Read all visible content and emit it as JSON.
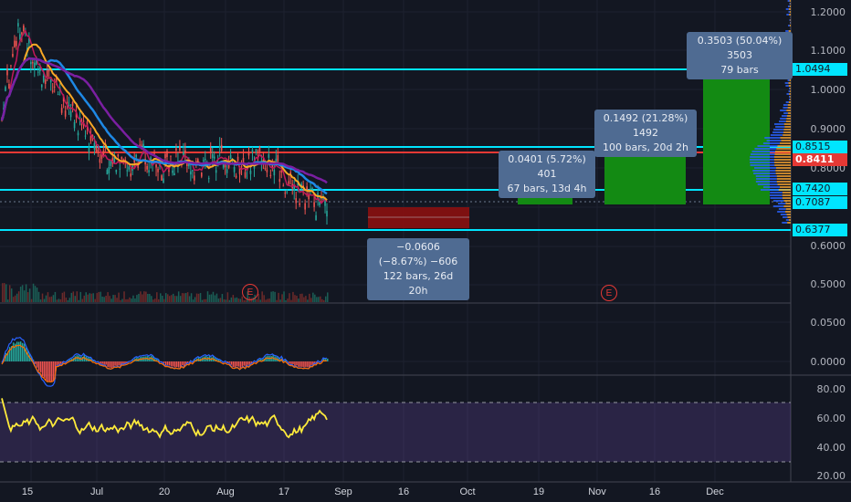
{
  "price_axis": {
    "main_labels": [
      "1.2000",
      "1.1000",
      "1.0000",
      "0.9000",
      "0.8000",
      "0.7000",
      "0.6000",
      "0.5000"
    ],
    "macd_labels": [
      "0.0500",
      "0.0000"
    ],
    "rsi_labels": [
      "80.00",
      "60.00",
      "40.00",
      "20.00"
    ]
  },
  "levels": {
    "l1": {
      "value": "1.0494",
      "color": "#00e5ff"
    },
    "l2": {
      "value": "0.8515",
      "color": "#00e5ff"
    },
    "current": {
      "value": "0.8411",
      "color": "#e53935"
    },
    "l3": {
      "value": "0.7420",
      "color": "#00e5ff"
    },
    "l4": {
      "value": "0.7087",
      "color": "#00e5ff"
    },
    "l5": {
      "value": "0.6377",
      "color": "#00e5ff"
    }
  },
  "measures": {
    "short": {
      "line1": "−0.0606 (−8.67%) −606",
      "line2": "122 bars, 26d 20h"
    },
    "long1": {
      "line1": "0.0401 (5.72%) 401",
      "line2": "67 bars, 13d 4h"
    },
    "long2": {
      "line1": "0.1492 (21.28%) 1492",
      "line2": "100 bars, 20d 2h"
    },
    "long3": {
      "line1": "0.3503 (50.04%) 3503",
      "line2": "79 bars"
    }
  },
  "events": {
    "label": "E"
  },
  "time_axis": [
    "15",
    "Jul",
    "20",
    "Aug",
    "17",
    "Sep",
    "16",
    "Oct",
    "19",
    "Nov",
    "16",
    "Dec"
  ],
  "colors": {
    "background": "#131722",
    "up": "#26a69a",
    "down": "#ef5350",
    "rsi": "#ffeb3b",
    "rsi_band": "#7e57c2"
  }
}
